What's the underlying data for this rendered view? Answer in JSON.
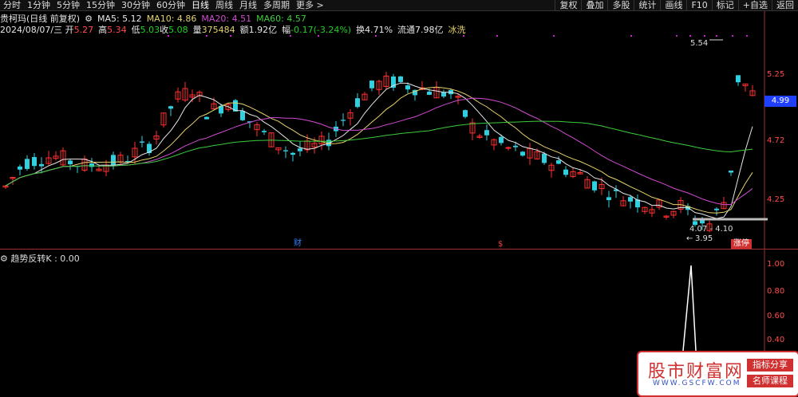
{
  "toolbar": {
    "periods": [
      "分时",
      "1分钟",
      "5分钟",
      "15分钟",
      "30分钟",
      "60分钟",
      "日线",
      "周线",
      "月线",
      "多周期",
      "更多 >"
    ],
    "active_period": "日线",
    "right_buttons": [
      "复权",
      "叠加",
      "多股",
      "统计",
      "画线",
      "F10",
      "标记",
      "+自选",
      "返回"
    ]
  },
  "info": {
    "name": "贵柯玛(日线 前复权)",
    "ma5": "MA5: 5.12",
    "ma10": "MA10: 4.86",
    "ma20": "MA20: 4.51",
    "ma60": "MA60: 4.57",
    "date": "2024/08/07/三",
    "open_label": "开",
    "open": "5.27",
    "high_label": "高",
    "high": "5.34",
    "low_label": "低",
    "low": "5.03",
    "close_label": "收",
    "close": "5.08",
    "vol_label": "量",
    "vol": "375484",
    "amt_label": "额",
    "amt": "1.92亿",
    "chg_label": "幅",
    "chg": "-0.17(-3.24%)",
    "turn_label": "换",
    "turn": "4.71%",
    "float_label": "流通",
    "float": "7.98亿",
    "status": "冰洗"
  },
  "axis": {
    "p1": "5.25",
    "p2": "4.72",
    "p3": "4.25",
    "current": "4.99",
    "s1": "1.00",
    "s2": "0.80",
    "s3": "0.60",
    "s4": "0.40"
  },
  "annotations": {
    "hi": "5.54",
    "range": "4.07 - 4.10",
    "lo": "3.95",
    "cai": "财",
    "marker": "$",
    "zt": "涨停"
  },
  "sub": {
    "title": "趋势反转K : 0.00"
  },
  "overlay": {
    "main": "股市财富网",
    "url": "WWW.GSCFW.COM",
    "tag1": "指标分享",
    "tag2": "名师课程"
  },
  "colors": {
    "up": "#ff3030",
    "down": "#30d0e0",
    "ma5": "#e6e6e6",
    "ma10": "#e6d26a",
    "ma20": "#d24ad2",
    "ma60": "#3ccc3c"
  }
}
